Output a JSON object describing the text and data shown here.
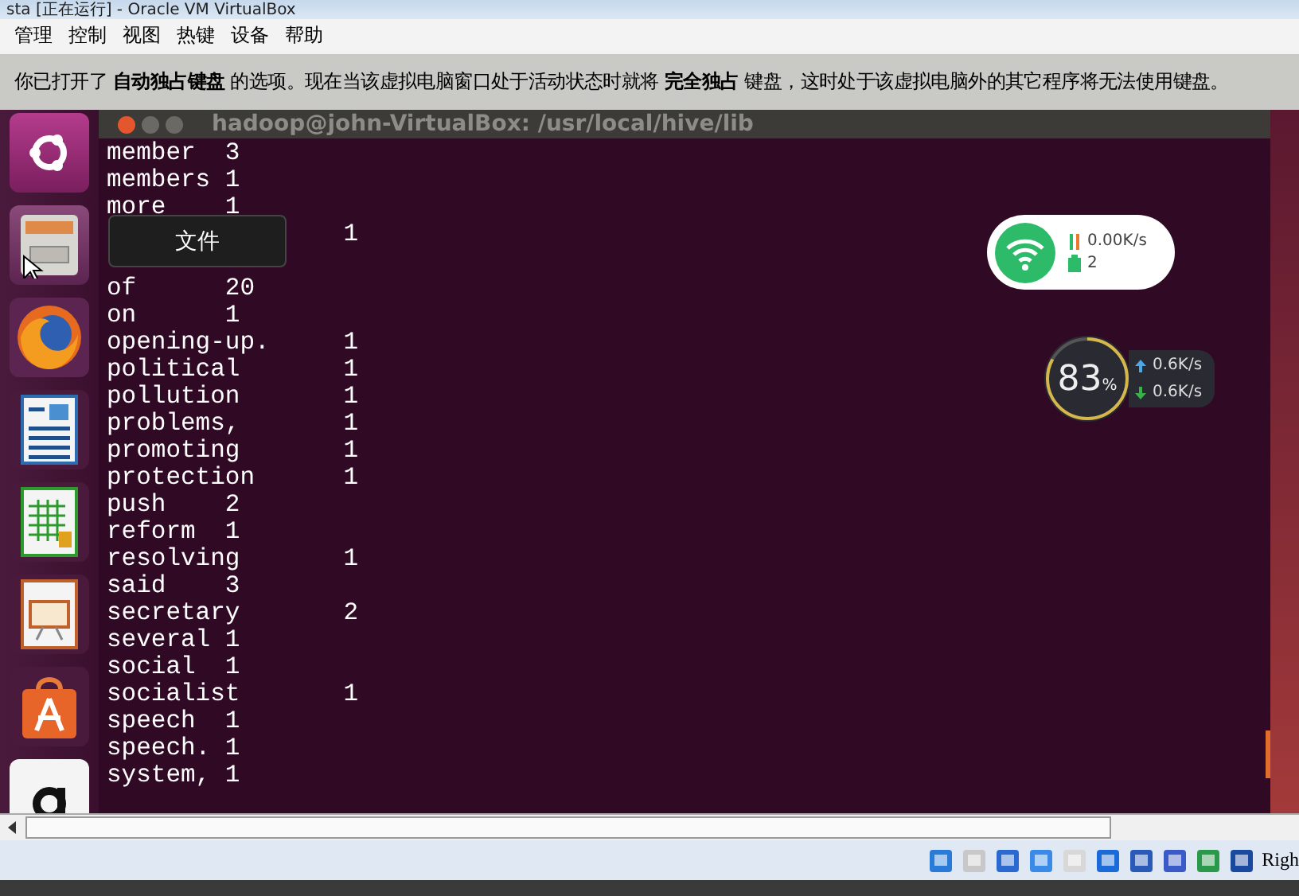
{
  "window": {
    "title": "sta [正在运行] - Oracle VM VirtualBox"
  },
  "menu": [
    "管理",
    "控制",
    "视图",
    "热键",
    "设备",
    "帮助"
  ],
  "notice": "你已打开了 **自动独占键盘** 的选项。现在当该虚拟电脑窗口处于活动状态时就将 **完全独占** 键盘，这时处于该虚拟电脑外的其它程序将无法使用键盘。",
  "launcher": {
    "items": [
      {
        "kind": "ubuntu"
      },
      {
        "kind": "files"
      },
      {
        "kind": "firefox"
      },
      {
        "kind": "writer"
      },
      {
        "kind": "calc"
      },
      {
        "kind": "impress"
      },
      {
        "kind": "store"
      },
      {
        "kind": "amazon"
      }
    ],
    "tooltip": "文件"
  },
  "terminal": {
    "title": "hadoop@john-VirtualBox: /usr/local/hive/lib",
    "lines": [
      {
        "word": "member",
        "count": "3"
      },
      {
        "word": "members",
        "count": "1"
      },
      {
        "word": "more",
        "count": "1"
      },
      {
        "count": "1"
      },
      {
        "covered": true
      },
      {
        "word": "of",
        "count": "20"
      },
      {
        "word": "on",
        "count": "1"
      },
      {
        "word": "opening-up.",
        "count": "1"
      },
      {
        "word": "political",
        "count": "1"
      },
      {
        "word": "pollution",
        "count": "1"
      },
      {
        "word": "problems,",
        "count": "1"
      },
      {
        "word": "promoting",
        "count": "1"
      },
      {
        "word": "protection",
        "count": "1"
      },
      {
        "word": "push",
        "count": "2"
      },
      {
        "word": "reform",
        "count": "1"
      },
      {
        "word": "resolving",
        "count": "1"
      },
      {
        "word": "said",
        "count": "3"
      },
      {
        "word": "secretary",
        "count": "2"
      },
      {
        "word": "several",
        "count": "1"
      },
      {
        "word": "social",
        "count": "1"
      },
      {
        "word": "socialist",
        "count": "1"
      },
      {
        "word": "speech",
        "count": "1"
      },
      {
        "word": "speech.",
        "count": "1"
      },
      {
        "word": "system,",
        "count": "1"
      }
    ]
  },
  "network_widget": {
    "speed": "0.00K/s",
    "count": "2"
  },
  "meter_widget": {
    "value": "83",
    "unit": "%",
    "level": 0.83,
    "up": "0.6K/s",
    "down": "0.6K/s"
  },
  "status_bar": {
    "text": "Righ"
  }
}
